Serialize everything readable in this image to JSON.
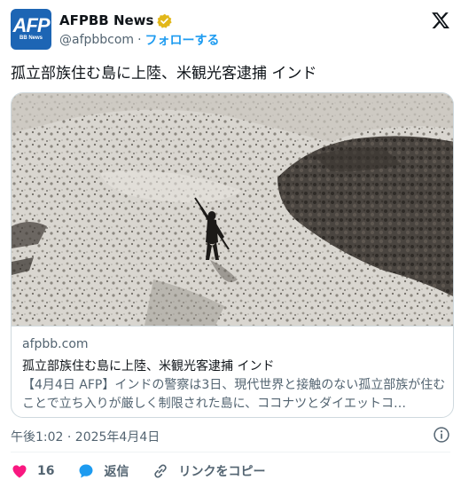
{
  "author": {
    "avatar_text": "AFP",
    "avatar_subtext": "BB News",
    "display_name": "AFPBB News",
    "handle": "@afpbbcom",
    "separator": "·",
    "follow_label": "フォローする"
  },
  "tweet": {
    "text": "孤立部族住む島に上陸、米観光客逮捕 インド"
  },
  "card": {
    "domain": "afpbb.com",
    "title": "孤立部族住む島に上陸、米観光客逮捕 インド",
    "description": "【4月4日 AFP】インドの警察は3日、現代世界と接触のない孤立部族が住むことで立ち入りが厳しく制限された島に、ココナツとダイエットコ…"
  },
  "timestamp": "午後1:02 · 2025年4月4日",
  "actions": {
    "like_count": "16",
    "reply_label": "返信",
    "copy_link_label": "リンクをコピー"
  },
  "colors": {
    "accent": "#1d9bf0",
    "like": "#f91880",
    "verified": "#e2b719",
    "text_secondary": "#536471"
  }
}
